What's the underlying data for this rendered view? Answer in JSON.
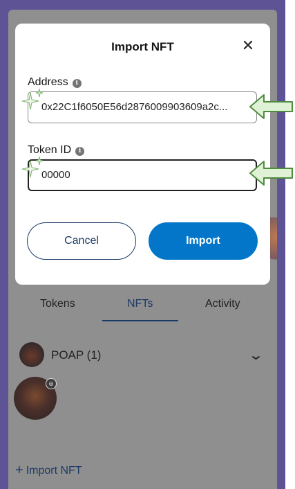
{
  "modal": {
    "title": "Import NFT",
    "close_glyph": "✕",
    "address_label": "Address",
    "address_value": "0x22C1f6050E56d2876009903609a2c...",
    "token_id_label": "Token ID",
    "token_id_value": "00000",
    "info_glyph": "i",
    "cancel_label": "Cancel",
    "import_label": "Import"
  },
  "tabs": {
    "tokens": "Tokens",
    "nfts": "NFTs",
    "activity": "Activity",
    "active": "NFTs"
  },
  "collection": {
    "name": "POAP (1)",
    "chevron": "⌄"
  },
  "footer": {
    "import_link_plus": "+",
    "import_link_label": "Import NFT"
  },
  "colors": {
    "frame": "#5e5394",
    "primary_button": "#0376c9",
    "link": "#1b3a66",
    "arrow_fill": "#dff2d6",
    "arrow_stroke": "#4e8b3d"
  },
  "icons": {
    "close": "close-icon",
    "info": "info-icon",
    "chevron": "chevron-down-icon",
    "sparkle": "sparkle-icon",
    "arrow": "arrow-left-icon"
  }
}
